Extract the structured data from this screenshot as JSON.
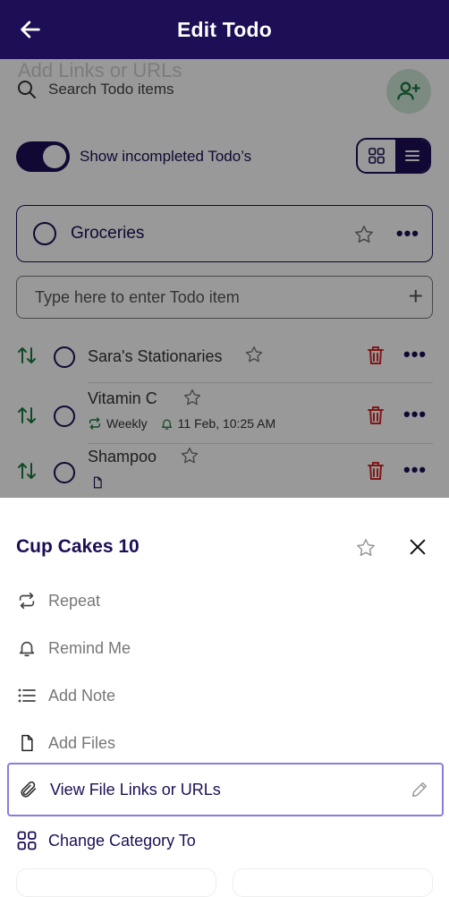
{
  "header": {
    "title": "Edit Todo"
  },
  "background": {
    "ghost_text": "Add Links or URLs",
    "search": {
      "placeholder": "Search Todo items"
    },
    "toggle": {
      "label": "Show incompleted Todo’s",
      "on": true
    },
    "view_mode": "list",
    "category": {
      "name": "Groceries"
    },
    "entry": {
      "placeholder": "Type here to enter Todo item"
    },
    "items": [
      {
        "name": "Sara's Stationaries"
      },
      {
        "name": "Vitamin C",
        "repeat": "Weekly",
        "reminder": "11 Feb, 10:25 AM"
      },
      {
        "name": "Shampoo",
        "has_file": true
      }
    ]
  },
  "sheet": {
    "title": "Cup Cakes 10",
    "options": [
      {
        "label": "Repeat",
        "icon": "repeat-icon"
      },
      {
        "label": "Remind Me",
        "icon": "bell-icon"
      },
      {
        "label": "Add Note",
        "icon": "list-icon"
      },
      {
        "label": "Add Files",
        "icon": "file-icon"
      },
      {
        "label": "View File Links or URLs",
        "icon": "paperclip-icon"
      },
      {
        "label": "Change Category To",
        "icon": "grid-icon"
      }
    ]
  },
  "colors": {
    "primary": "#1d0e55",
    "accent_green": "#1a7a3c",
    "danger": "#d62828",
    "selection": "#8a7be0"
  }
}
